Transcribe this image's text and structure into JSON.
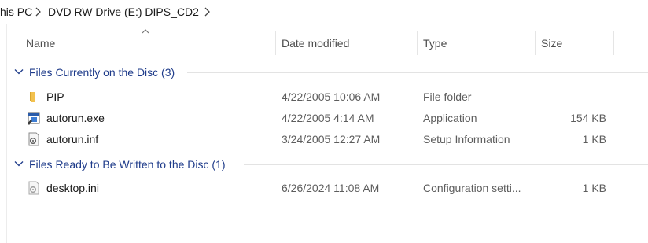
{
  "breadcrumb": {
    "items": [
      "his PC",
      "DVD RW Drive (E:) DIPS_CD2"
    ]
  },
  "columns": {
    "name": "Name",
    "date_modified": "Date modified",
    "type": "Type",
    "size": "Size",
    "sorted_by": "Name",
    "sort_direction": "ascending"
  },
  "groups": [
    {
      "title": "Files Currently on the Disc (3)",
      "expanded": true,
      "files": [
        {
          "name": "PIP",
          "date": "4/22/2005 10:06 AM",
          "type": "File folder",
          "size": "",
          "icon": "folder-icon"
        },
        {
          "name": "autorun.exe",
          "date": "4/22/2005 4:14 AM",
          "type": "Application",
          "size": "154 KB",
          "icon": "application-icon"
        },
        {
          "name": "autorun.inf",
          "date": "3/24/2005 12:27 AM",
          "type": "Setup Information",
          "size": "1 KB",
          "icon": "setup-info-file-icon"
        }
      ]
    },
    {
      "title": "Files Ready to Be Written to the Disc (1)",
      "expanded": true,
      "files": [
        {
          "name": "desktop.ini",
          "date": "6/26/2024 11:08 AM",
          "type": "Configuration setti...",
          "size": "1 KB",
          "icon": "config-file-icon"
        }
      ]
    }
  ],
  "colors": {
    "group_title": "#1e3b8a",
    "folder": "#f2c14e",
    "divider": "#e5e5e5"
  }
}
